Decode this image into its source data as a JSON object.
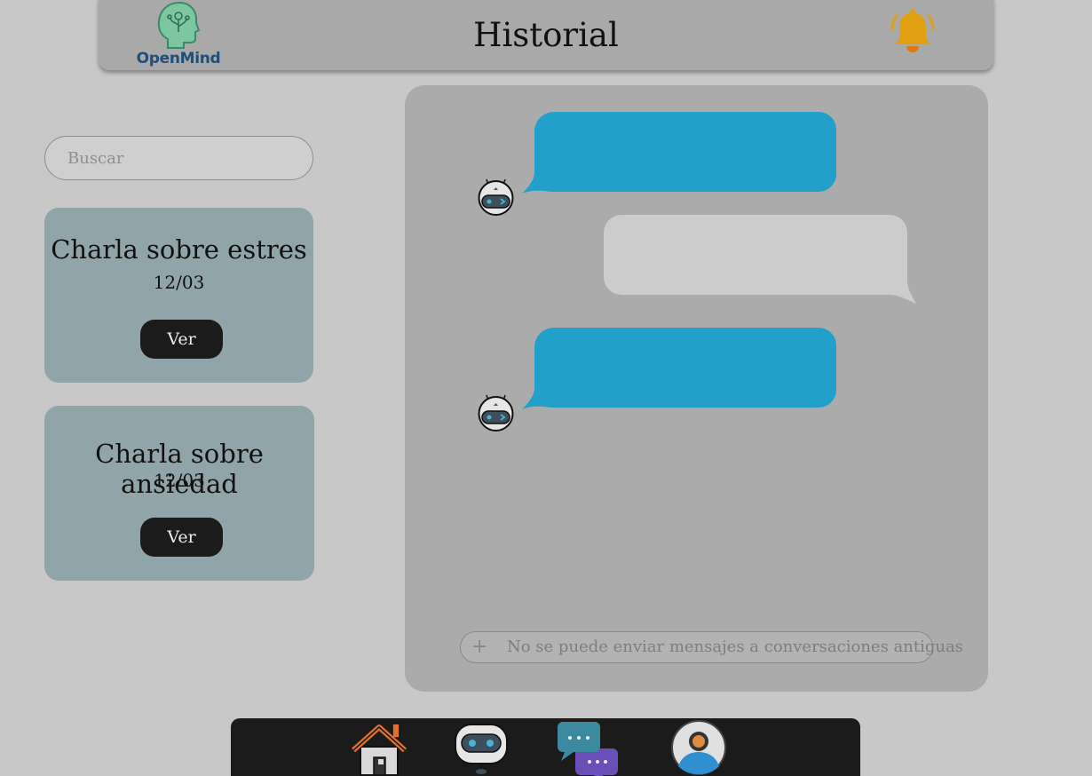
{
  "header": {
    "logo_text": "OpenMind",
    "title": "Historial",
    "notification_icon": "bell-icon"
  },
  "sidebar": {
    "search_placeholder": "Buscar",
    "conversations": [
      {
        "title": "Charla sobre estres",
        "date": "12/03",
        "button": "Ver"
      },
      {
        "title": "Charla sobre ansiedad",
        "date": "12/03",
        "button": "Ver"
      }
    ]
  },
  "chat": {
    "messages": [
      {
        "sender": "bot",
        "color": "#22a0ca"
      },
      {
        "sender": "user",
        "color": "#cccccc"
      },
      {
        "sender": "bot",
        "color": "#22a0ca"
      }
    ],
    "input_placeholder": "No se puede enviar mensajes a conversaciones antiguas",
    "plus_icon": "+"
  },
  "nav": {
    "items": [
      "home-icon",
      "robot-icon",
      "chat-bubbles-icon",
      "profile-icon"
    ]
  },
  "colors": {
    "background": "#c8c8c8",
    "header": "#a9a9a9",
    "card": "#8fa5aa",
    "bot_bubble": "#22a0ca",
    "user_bubble": "#cccccc",
    "bell": "#e0a010",
    "navbar": "#1b1b1b"
  }
}
